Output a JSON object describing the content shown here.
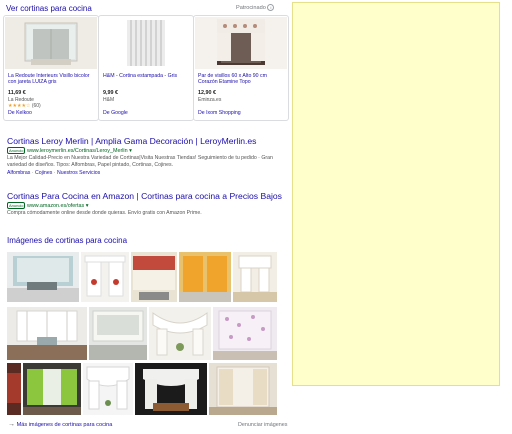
{
  "shopping": {
    "header": "Ver cortinas para cocina",
    "sponsored": "Patrocinado",
    "products": [
      {
        "title": "La Redoute Interieurs Visillo bicolor con jareta LUIZA gris",
        "price": "11,69 €",
        "store": "La Redoute",
        "rating": "★★★★☆",
        "reviews": "(60)",
        "via": "De Kelkoo"
      },
      {
        "title": "H&M - Cortina estampada - Gris",
        "price": "9,99 €",
        "store": "H&M",
        "via": "De Google"
      },
      {
        "title": "Par de visillos 60 x Alto 90 cm Corazón Etamine Topo",
        "price": "12,90 €",
        "store": "Eminza.es",
        "via": "De Ixom Shopping"
      }
    ]
  },
  "ads": [
    {
      "title": "Cortinas Leroy Merlin | Amplia Gama Decoración | LeroyMerlin.es",
      "badge": "Anuncio",
      "url": "www.leroymerlin.es/Cortinas/Leroy_Merlin",
      "desc": "La Mejor Calidad-Precio en Nuestra Variedad de Cortinas|Visita Nuestras Tiendas! Seguimiento de tu pedido · Gran variedad de diseños. Tipos: Alfombras, Papel pintado, Cortinas, Cojines.",
      "sitelinks": [
        "Alfombras",
        "Cojines",
        "Nuestros Servicios"
      ]
    },
    {
      "title": "Cortinas Para Cocina en Amazon | Cortinas para cocina a Precios Bajos",
      "badge": "Anuncio",
      "url": "www.amazon.es/ofertas",
      "desc": "Compra cómodamente online desde donde quieras. Envío gratis con Amazon Prime."
    }
  ],
  "images": {
    "header": "Imágenes de cortinas para cocina",
    "more": "Más imágenes de cortinas para cocina",
    "report": "Denunciar imágenes"
  },
  "colors": {
    "link": "#1a0dab",
    "url_green": "#006621",
    "side_panel": "#ffffcc",
    "side_panel_border": "#e6e08a"
  }
}
